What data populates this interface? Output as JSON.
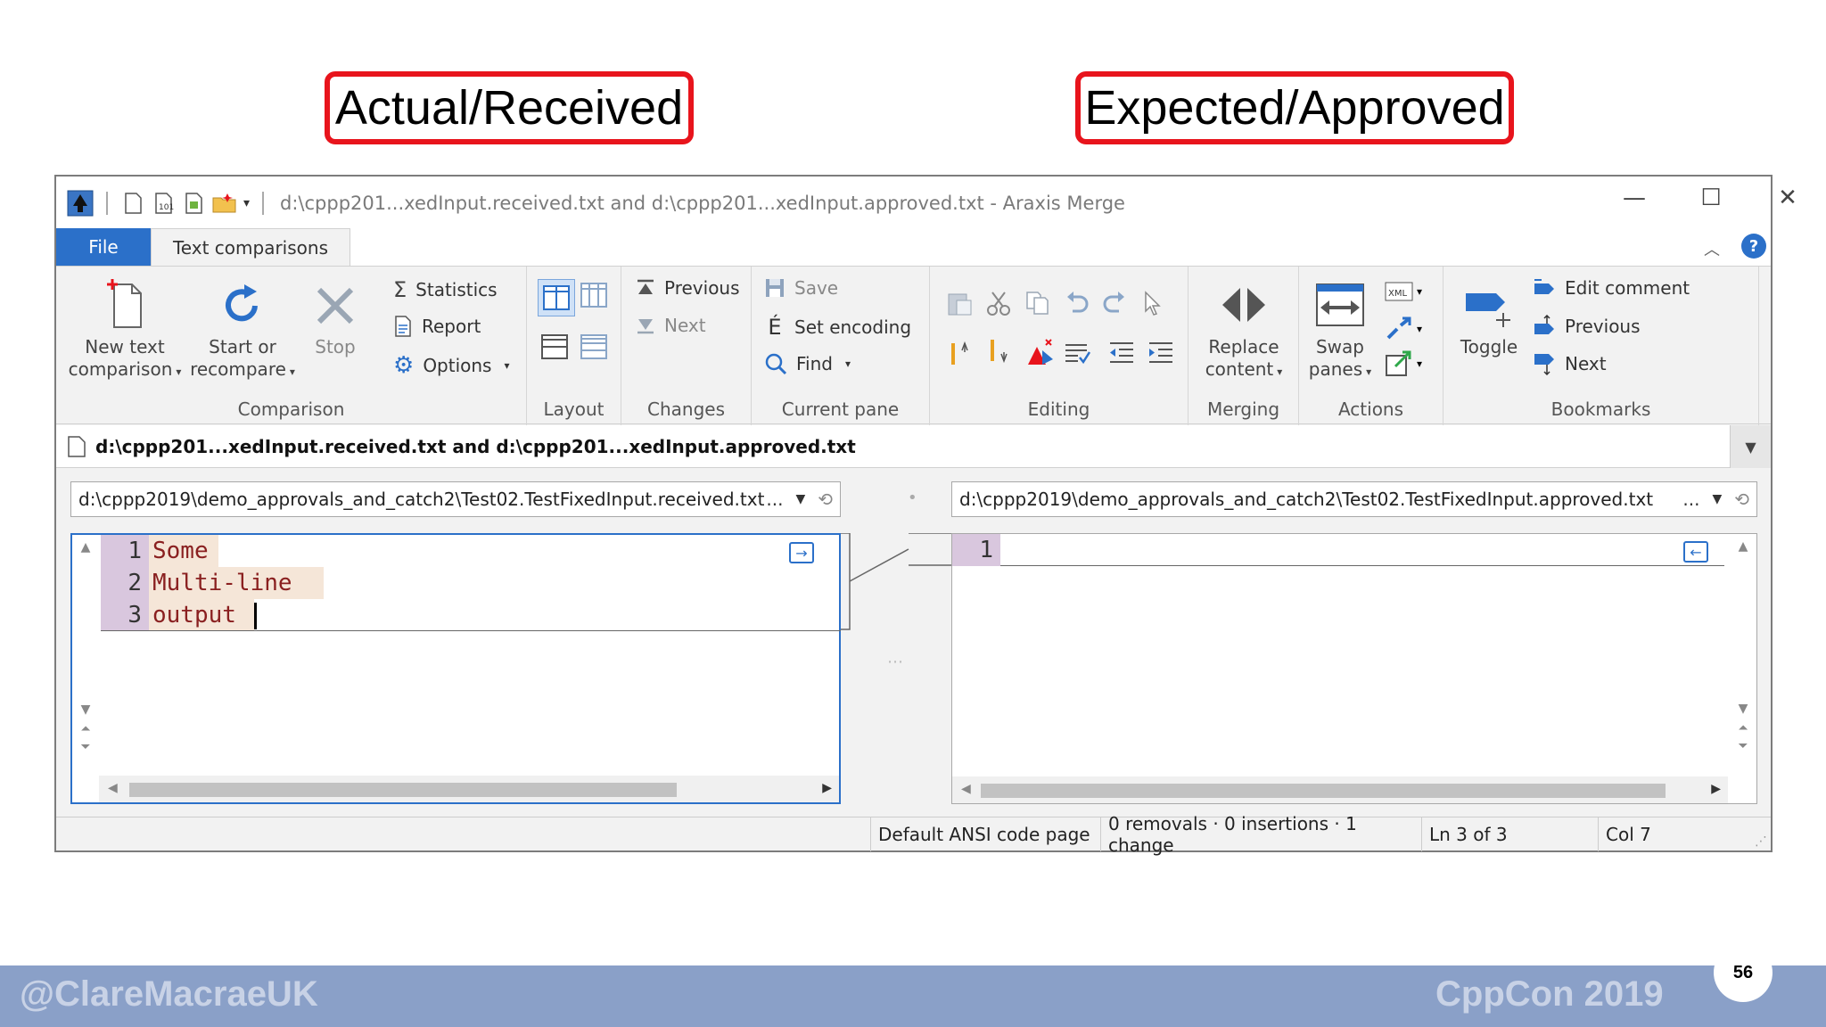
{
  "callouts": {
    "left": "Actual/Received",
    "right": "Expected/Approved"
  },
  "window": {
    "title": "d:\\cppp201...xedInput.received.txt and d:\\cppp201...xedInput.approved.txt - Araxis Merge",
    "minimize": "—",
    "maximize": "☐",
    "close": "✕"
  },
  "tabs": {
    "file": "File",
    "text_comparisons": "Text comparisons"
  },
  "ribbon": {
    "comparison": {
      "label": "Comparison",
      "new_text_1": "New text",
      "new_text_2": "comparison",
      "start_1": "Start or",
      "start_2": "recompare",
      "stop": "Stop",
      "statistics": "Statistics",
      "report": "Report",
      "options": "Options"
    },
    "layout": {
      "label": "Layout"
    },
    "changes": {
      "label": "Changes",
      "previous": "Previous",
      "next": "Next"
    },
    "current_pane": {
      "label": "Current pane",
      "save": "Save",
      "set_encoding": "Set encoding",
      "find": "Find"
    },
    "editing": {
      "label": "Editing"
    },
    "merging": {
      "label": "Merging",
      "replace_1": "Replace",
      "replace_2": "content"
    },
    "actions": {
      "label": "Actions",
      "swap_1": "Swap",
      "swap_2": "panes"
    },
    "bookmarks": {
      "label": "Bookmarks",
      "toggle": "Toggle",
      "edit_comment": "Edit comment",
      "previous": "Previous",
      "next": "Next"
    }
  },
  "address": {
    "title": "d:\\cppp201...xedInput.received.txt and d:\\cppp201...xedInput.approved.txt"
  },
  "left_pane": {
    "path": "d:\\cppp2019\\demo_approvals_and_catch2\\Test02.TestFixedInput.received.txt",
    "ellipsis": "...",
    "lines": [
      {
        "num": "1",
        "text": "Some"
      },
      {
        "num": "2",
        "text": "Multi-line"
      },
      {
        "num": "3",
        "text": "output"
      }
    ]
  },
  "right_pane": {
    "path": "d:\\cppp2019\\demo_approvals_and_catch2\\Test02.TestFixedInput.approved.txt",
    "ellipsis": "...",
    "lines": [
      {
        "num": "1",
        "text": ""
      }
    ]
  },
  "status": {
    "encoding": "Default ANSI code page",
    "summary": "0 removals · 0 insertions · 1 change",
    "line": "Ln 3 of 3",
    "col": "Col 7"
  },
  "footer": {
    "handle": "@ClareMacraeUK",
    "conference": "CppCon 2019",
    "page": "56"
  },
  "colors": {
    "accent": "#2b70c9",
    "callout_border": "#e8141c",
    "footer": "#8aa0c8",
    "gutter": "#d9c7de",
    "changed_line": "#f5e6d8"
  }
}
